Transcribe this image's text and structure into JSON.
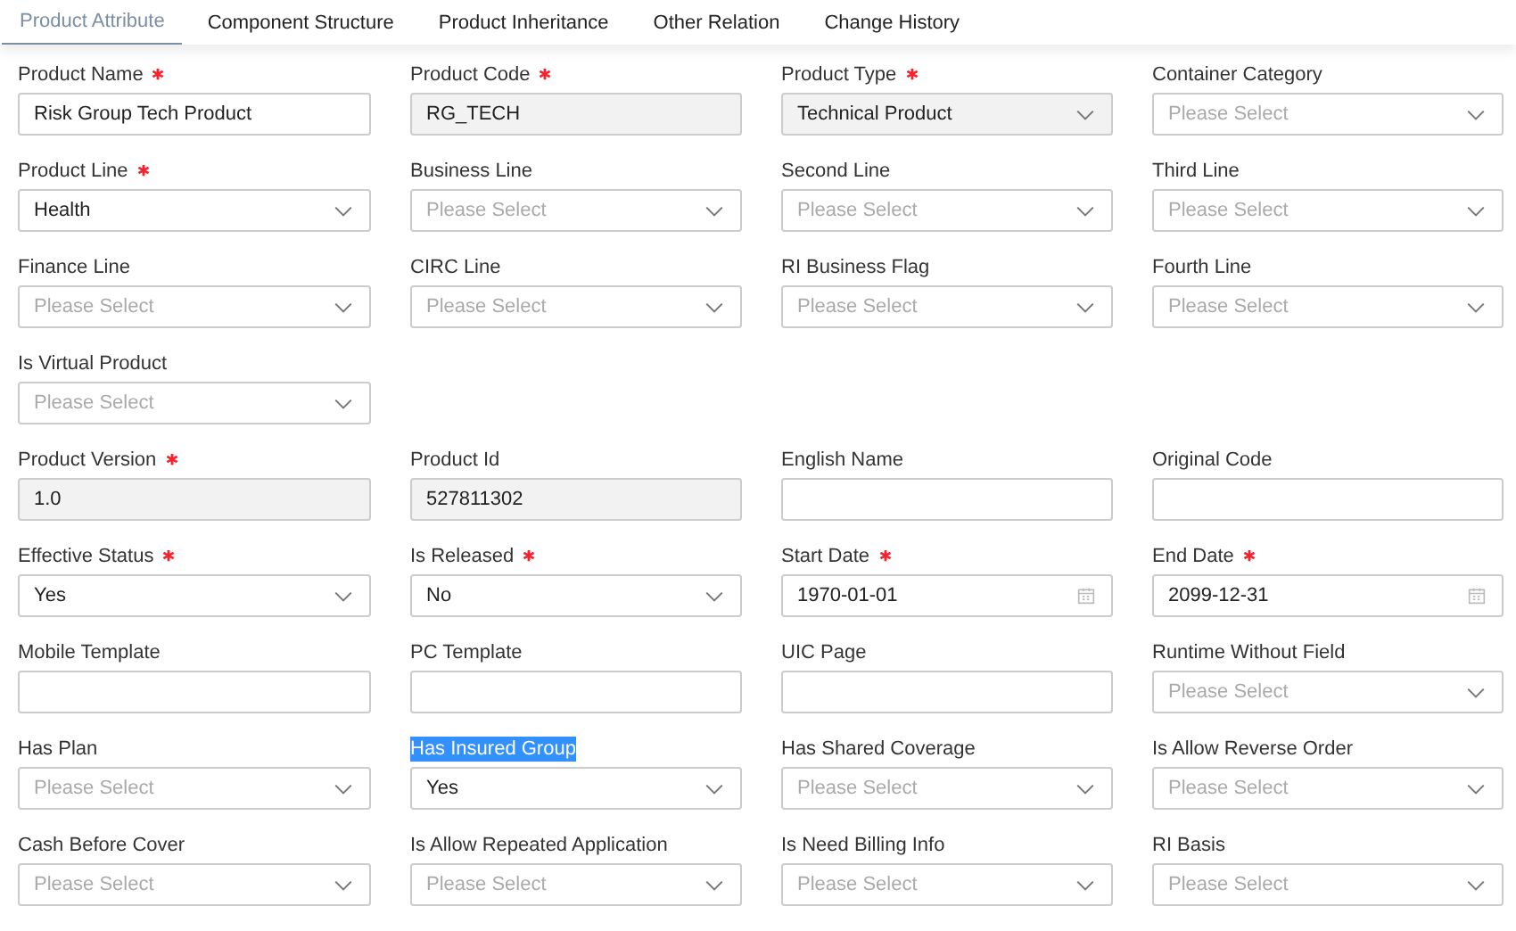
{
  "tabs": [
    {
      "label": "Product Attribute",
      "selected": true
    },
    {
      "label": "Component Structure",
      "selected": false
    },
    {
      "label": "Product Inheritance",
      "selected": false
    },
    {
      "label": "Other Relation",
      "selected": false
    },
    {
      "label": "Change History",
      "selected": false
    }
  ],
  "rows": [
    [
      {
        "label": "Product Name",
        "kind": "input",
        "required": true,
        "disabled": false,
        "highlighted": false,
        "value": "Risk Group Tech Product"
      },
      {
        "label": "Product Code",
        "kind": "input",
        "required": true,
        "disabled": true,
        "highlighted": false,
        "value": "RG_TECH"
      },
      {
        "label": "Product Type",
        "kind": "select",
        "required": true,
        "disabled": true,
        "highlighted": false,
        "value": "Technical Product"
      },
      {
        "label": "Container Category",
        "kind": "select",
        "required": false,
        "disabled": false,
        "highlighted": false,
        "placeholder": "Please Select"
      }
    ],
    [
      {
        "label": "Product Line",
        "kind": "select",
        "required": true,
        "disabled": false,
        "highlighted": false,
        "value": "Health"
      },
      {
        "label": "Business Line",
        "kind": "select",
        "required": false,
        "disabled": false,
        "highlighted": false,
        "placeholder": "Please Select"
      },
      {
        "label": "Second Line",
        "kind": "select",
        "required": false,
        "disabled": false,
        "highlighted": false,
        "placeholder": "Please Select"
      },
      {
        "label": "Third Line",
        "kind": "select",
        "required": false,
        "disabled": false,
        "highlighted": false,
        "placeholder": "Please Select"
      }
    ],
    [
      {
        "label": "Finance Line",
        "kind": "select",
        "required": false,
        "disabled": false,
        "highlighted": false,
        "placeholder": "Please Select"
      },
      {
        "label": "CIRC Line",
        "kind": "select",
        "required": false,
        "disabled": false,
        "highlighted": false,
        "placeholder": "Please Select"
      },
      {
        "label": "RI Business Flag",
        "kind": "select",
        "required": false,
        "disabled": false,
        "highlighted": false,
        "placeholder": "Please Select"
      },
      {
        "label": "Fourth Line",
        "kind": "select",
        "required": false,
        "disabled": false,
        "highlighted": false,
        "placeholder": "Please Select"
      }
    ],
    [
      {
        "label": "Is Virtual Product",
        "kind": "select",
        "required": false,
        "disabled": false,
        "highlighted": false,
        "placeholder": "Please Select"
      }
    ],
    [
      {
        "label": "Product Version",
        "kind": "input",
        "required": true,
        "disabled": true,
        "highlighted": false,
        "value": "1.0"
      },
      {
        "label": "Product Id",
        "kind": "input",
        "required": false,
        "disabled": true,
        "highlighted": false,
        "value": "527811302"
      },
      {
        "label": "English Name",
        "kind": "input",
        "required": false,
        "disabled": false,
        "highlighted": false
      },
      {
        "label": "Original Code",
        "kind": "input",
        "required": false,
        "disabled": false,
        "highlighted": false
      }
    ],
    [
      {
        "label": "Effective Status",
        "kind": "select",
        "required": true,
        "disabled": false,
        "highlighted": false,
        "value": "Yes"
      },
      {
        "label": "Is Released",
        "kind": "select",
        "required": true,
        "disabled": false,
        "highlighted": false,
        "value": "No"
      },
      {
        "label": "Start Date",
        "kind": "date",
        "required": true,
        "disabled": false,
        "highlighted": false,
        "value": "1970-01-01"
      },
      {
        "label": "End Date",
        "kind": "date",
        "required": true,
        "disabled": false,
        "highlighted": false,
        "value": "2099-12-31"
      }
    ],
    [
      {
        "label": "Mobile Template",
        "kind": "input",
        "required": false,
        "disabled": false,
        "highlighted": false
      },
      {
        "label": "PC Template",
        "kind": "input",
        "required": false,
        "disabled": false,
        "highlighted": false
      },
      {
        "label": "UIC Page",
        "kind": "input",
        "required": false,
        "disabled": false,
        "highlighted": false
      },
      {
        "label": "Runtime Without Field",
        "kind": "select",
        "required": false,
        "disabled": false,
        "highlighted": false,
        "placeholder": "Please Select"
      }
    ],
    [
      {
        "label": "Has Plan",
        "kind": "select",
        "required": false,
        "disabled": false,
        "highlighted": false,
        "placeholder": "Please Select"
      },
      {
        "label": "Has Insured Group",
        "kind": "select",
        "required": false,
        "disabled": false,
        "highlighted": true,
        "value": "Yes"
      },
      {
        "label": "Has Shared Coverage",
        "kind": "select",
        "required": false,
        "disabled": false,
        "highlighted": false,
        "placeholder": "Please Select"
      },
      {
        "label": "Is Allow Reverse Order",
        "kind": "select",
        "required": false,
        "disabled": false,
        "highlighted": false,
        "placeholder": "Please Select"
      }
    ],
    [
      {
        "label": "Cash Before Cover",
        "kind": "select",
        "required": false,
        "disabled": false,
        "highlighted": false,
        "placeholder": "Please Select"
      },
      {
        "label": "Is Allow Repeated Application",
        "kind": "select",
        "required": false,
        "disabled": false,
        "highlighted": false,
        "placeholder": "Please Select"
      },
      {
        "label": "Is Need Billing Info",
        "kind": "select",
        "required": false,
        "disabled": false,
        "highlighted": false,
        "placeholder": "Please Select"
      },
      {
        "label": "RI Basis",
        "kind": "select",
        "required": false,
        "disabled": false,
        "highlighted": false,
        "placeholder": "Please Select"
      }
    ]
  ]
}
